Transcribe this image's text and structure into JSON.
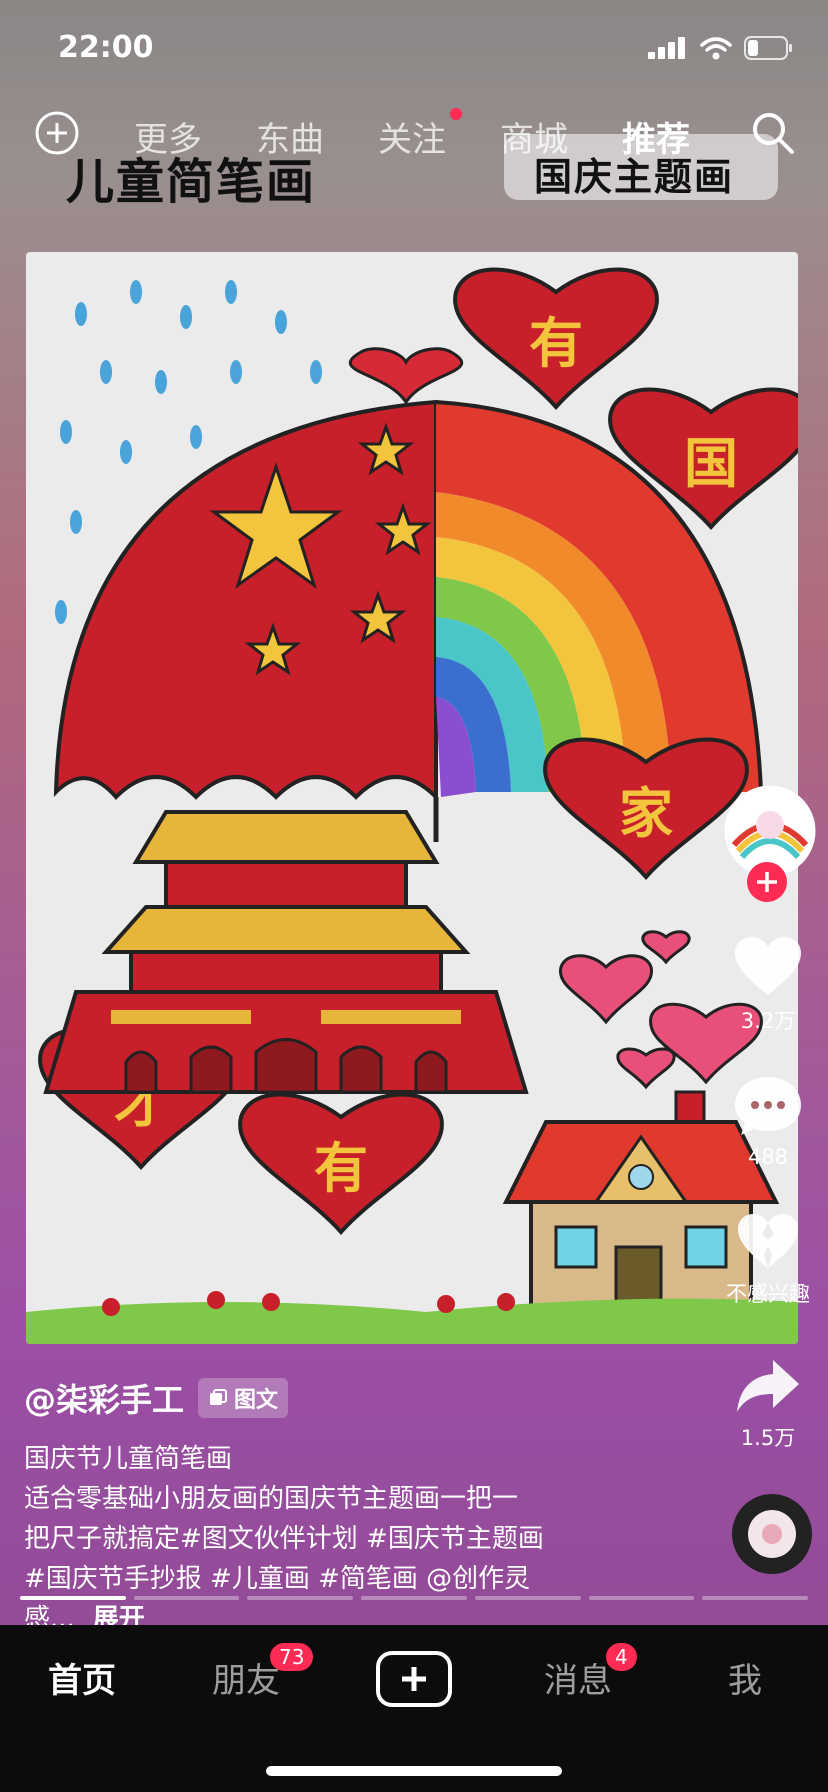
{
  "status_bar": {
    "time": "22:00"
  },
  "top_nav": {
    "tabs": [
      "更多",
      "东曲",
      "关注",
      "商城",
      "推荐"
    ],
    "active_tab": "推荐"
  },
  "overlay": {
    "title_left": "儿童简笔画",
    "title_right": "国庆主题画"
  },
  "poster_text": {
    "heart1": "有",
    "heart2": "国",
    "heart3": "家",
    "heart4": "才",
    "heart5": "有"
  },
  "side_actions": {
    "likes": "3.2万",
    "comments": "488",
    "not_interested": "不感兴趣",
    "shares": "1.5万"
  },
  "caption": {
    "author": "@柒彩手工",
    "type_tag": "图文",
    "line1": "国庆节儿童简笔画",
    "line2": "适合零基础小朋友画的国庆节主题画一把一",
    "line3": "把尺子就搞定#图文伙伴计划 #国庆节主题画",
    "line4": "#国庆节手抄报 #儿童画 #简笔画 @创作灵",
    "line5": "感...",
    "expand": "展开"
  },
  "tab_bar": {
    "home": "首页",
    "friends": "朋友",
    "friends_badge": "73",
    "messages": "消息",
    "messages_badge": "4",
    "me": "我"
  },
  "colors": {
    "accent": "#fe2c55",
    "flag_red": "#c8202a",
    "star_yellow": "#f2c53d"
  }
}
